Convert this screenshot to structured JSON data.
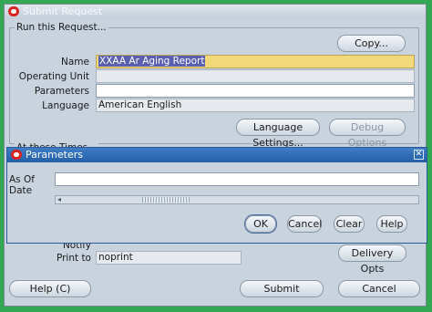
{
  "main_window": {
    "title": "Submit Request",
    "group_title": "Run this Request...",
    "copy_button": "Copy...",
    "fields": [
      {
        "label": "Name",
        "value": "XXAA Ar Aging Report"
      },
      {
        "label": "Operating Unit",
        "value": ""
      },
      {
        "label": "Parameters",
        "value": ""
      },
      {
        "label": "Language",
        "value": "American English"
      }
    ],
    "language_settings_button": "Language Settings...",
    "debug_options_button": "Debug Options",
    "schedule_group_title": "At these Times...",
    "notify_label": "Notify",
    "print_to_label": "Print to",
    "print_to_value": "noprint",
    "delivery_opts_button": "Delivery Opts",
    "help_button": "Help (C)",
    "submit_button": "Submit",
    "cancel_button": "Cancel"
  },
  "parameters_dialog": {
    "title": "Parameters",
    "as_of_date_label": "As Of Date",
    "as_of_date_value": "",
    "ok_button": "OK",
    "cancel_button": "Cancel",
    "clear_button": "Clear",
    "help_button": "Help"
  },
  "colors": {
    "background_green": "#33a852",
    "name_field_yellow": "#f1d97a",
    "dialog_titlebar_blue": "#2f6db8",
    "window_grey_blue": "#c9d3de"
  }
}
